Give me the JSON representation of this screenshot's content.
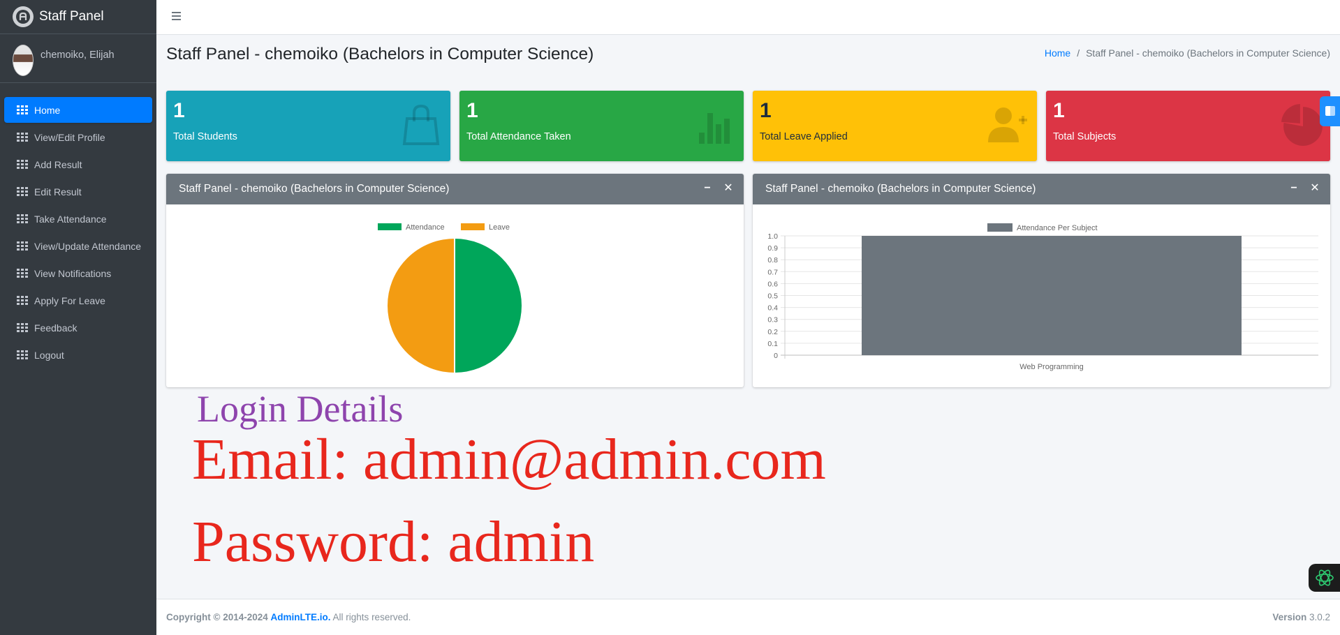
{
  "brand": {
    "name": "Staff Panel",
    "logo_letter": "A"
  },
  "user": {
    "name": "chemoiko, Elijah"
  },
  "sidebar": {
    "items": [
      {
        "label": "Home",
        "active": true
      },
      {
        "label": "View/Edit Profile"
      },
      {
        "label": "Add Result"
      },
      {
        "label": "Edit Result"
      },
      {
        "label": "Take Attendance"
      },
      {
        "label": "View/Update Attendance"
      },
      {
        "label": "View Notifications"
      },
      {
        "label": "Apply For Leave"
      },
      {
        "label": "Feedback"
      },
      {
        "label": "Logout"
      }
    ]
  },
  "header": {
    "title": "Staff Panel - chemoiko (Bachelors in Computer Science)",
    "breadcrumb": {
      "home": "Home",
      "sep": "/",
      "current": "Staff Panel - chemoiko (Bachelors in Computer Science)"
    }
  },
  "stats": [
    {
      "value": "1",
      "label": "Total Students",
      "icon": "shopping-bag-icon",
      "color": "#17a2b8"
    },
    {
      "value": "1",
      "label": "Total Attendance Taken",
      "icon": "bar-chart-icon",
      "color": "#28a745"
    },
    {
      "value": "1",
      "label": "Total Leave Applied",
      "icon": "user-plus-icon",
      "color": "#ffc107"
    },
    {
      "value": "1",
      "label": "Total Subjects",
      "icon": "pie-chart-icon",
      "color": "#dc3545"
    }
  ],
  "cards": {
    "left_title": "Staff Panel - chemoiko (Bachelors in Computer Science)",
    "right_title": "Staff Panel - chemoiko (Bachelors in Computer Science)"
  },
  "chart_data": [
    {
      "type": "pie",
      "labels": [
        "Attendance",
        "Leave"
      ],
      "values": [
        1,
        1
      ],
      "colors": [
        "#00a65a",
        "#f39c12"
      ],
      "legend": "top"
    },
    {
      "type": "bar",
      "categories": [
        "Web Programming"
      ],
      "series": [
        {
          "name": "Attendance Per Subject",
          "values": [
            1.0
          ],
          "color": "#6c757d"
        }
      ],
      "ylim": [
        0,
        1.0
      ],
      "yticks": [
        "1.0",
        "0.9",
        "0.8",
        "0.7",
        "0.6",
        "0.5",
        "0.4",
        "0.3",
        "0.2",
        "0.1",
        "0"
      ],
      "grid": true,
      "legend": "top"
    }
  ],
  "login": {
    "title": "Login Details",
    "email": "Email: admin@admin.com",
    "password": "Password: admin"
  },
  "footer": {
    "copyright": "Copyright © 2014-2024",
    "link": "AdminLTE.io.",
    "rights": "All rights reserved.",
    "version_label": "Version",
    "version": "3.0.2"
  }
}
